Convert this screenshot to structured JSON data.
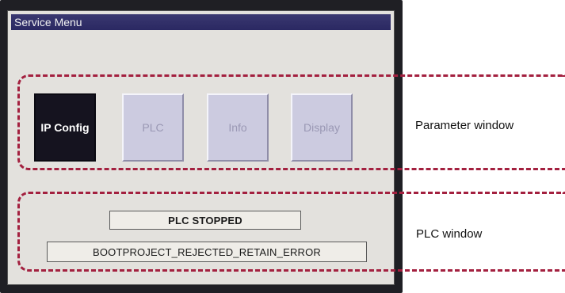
{
  "window": {
    "title": "Service Menu"
  },
  "menu": {
    "buttons": [
      {
        "label": "IP Config",
        "state": "active"
      },
      {
        "label": "PLC",
        "state": "inactive"
      },
      {
        "label": "Info",
        "state": "inactive"
      },
      {
        "label": "Display",
        "state": "inactive"
      }
    ]
  },
  "plc": {
    "status": "PLC STOPPED",
    "message": "BOOTPROJECT_REJECTED_RETAIN_ERROR"
  },
  "annotations": {
    "parameter_window": "Parameter window",
    "plc_window": "PLC window",
    "outline_color": "#a3203f"
  },
  "colors": {
    "title_bar": "#2a2862",
    "active_button": "#15131f",
    "inactive_button": "#cccbe0",
    "screen_background": "#e3e1dd"
  }
}
